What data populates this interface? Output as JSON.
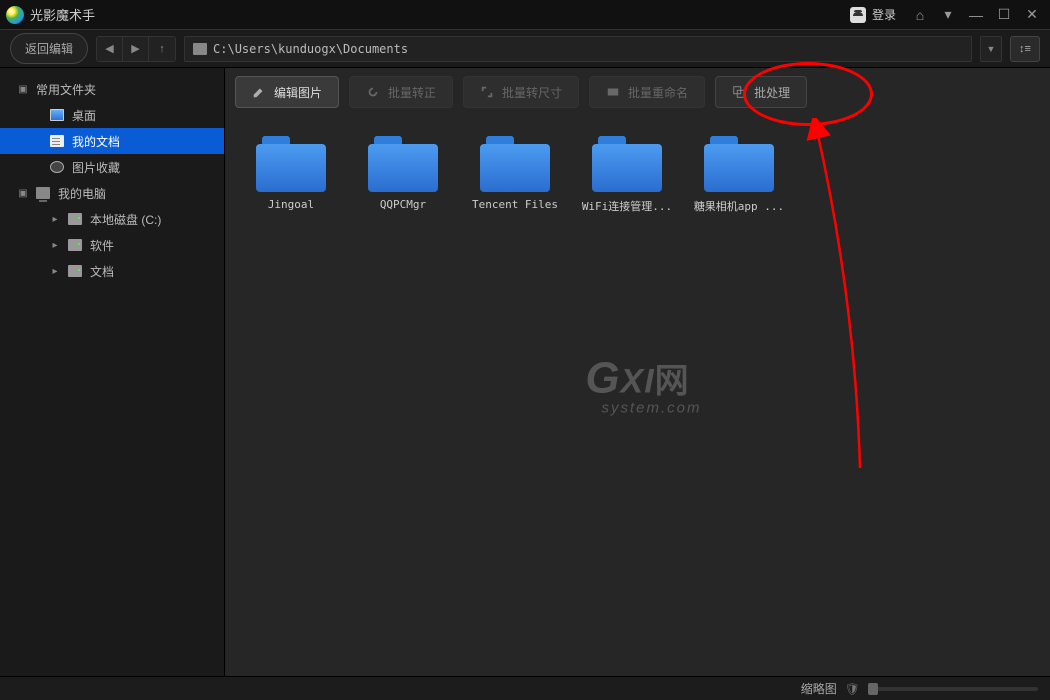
{
  "titlebar": {
    "app_name": "光影魔术手",
    "login_label": "登录"
  },
  "pathbar": {
    "back_label": "返回编辑",
    "path": "C:\\Users\\kunduogx\\Documents"
  },
  "sidebar": {
    "group1_label": "常用文件夹",
    "desktop": "桌面",
    "my_docs": "我的文档",
    "favorites": "图片收藏",
    "group2_label": "我的电脑",
    "disk_c": "本地磁盘 (C:)",
    "soft": "软件",
    "docs": "文档"
  },
  "actions": {
    "edit": "编辑图片",
    "rotate": "批量转正",
    "resize": "批量转尺寸",
    "rename": "批量重命名",
    "batch": "批处理"
  },
  "folders": [
    {
      "label": "Jingoal"
    },
    {
      "label": "QQPCMgr"
    },
    {
      "label": "Tencent Files"
    },
    {
      "label": "WiFi连接管理..."
    },
    {
      "label": "糖果相机app ..."
    }
  ],
  "watermark": {
    "line1a": "G",
    "line1b": "XI",
    "line1c": "网",
    "line2": "system.com"
  },
  "statusbar": {
    "thumb_label": "缩略图"
  }
}
